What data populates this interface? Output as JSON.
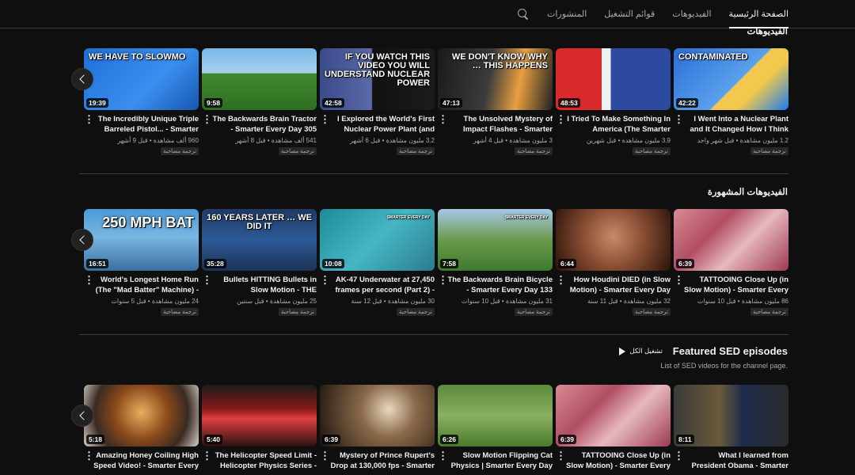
{
  "tabs": [
    {
      "label": "الصفحة الرئيسية",
      "active": true
    },
    {
      "label": "الفيديوهات",
      "active": false
    },
    {
      "label": "قوائم التشغيل",
      "active": false
    },
    {
      "label": "المنشورات",
      "active": false
    }
  ],
  "section_videos": {
    "title": "الفيديوهات",
    "items": [
      {
        "title": "I Went Into a Nuclear Plant and It Changed How I Think",
        "stats": "1.2 مليون مشاهدة • قبل شهر واحد",
        "duration": "42:22",
        "badge": "ترجمة مصاحبة",
        "overlay": "CONTAMINATED"
      },
      {
        "title": "I Tried To Make Something In America (The Smarter",
        "stats": "3.9 مليون مشاهدة • قبل شهرين",
        "duration": "48:53",
        "badge": "ترجمة مصاحبة",
        "overlay": ""
      },
      {
        "title": "The Unsolved Mystery of Impact Flashes - Smarter",
        "stats": "3 مليون مشاهدة • قبل 4 أشهر",
        "duration": "47:13",
        "badge": "ترجمة مصاحبة",
        "overlay": "WE DON'T KNOW WHY … THIS HAPPENS"
      },
      {
        "title": "I Explored the World's First Nuclear Power Plant (and",
        "stats": "3.2 مليون مشاهدة • قبل 6 أشهر",
        "duration": "42:58",
        "badge": "ترجمة مصاحبة",
        "overlay": "IF YOU WATCH THIS VIDEO YOU WILL UNDERSTAND NUCLEAR POWER"
      },
      {
        "title": "The Backwards Brain Tractor - Smarter Every Day 305",
        "stats": "541 ألف مشاهدة • قبل 8 أشهر",
        "duration": "9:58",
        "badge": "ترجمة مصاحبة",
        "overlay": ""
      },
      {
        "title": "The Incredibly Unique Triple Barreled Pistol... - Smarter",
        "stats": "960 ألف مشاهدة • قبل 9 أشهر",
        "duration": "19:39",
        "badge": "ترجمة مصاحبة",
        "overlay": "WE HAVE TO SLOWMO"
      }
    ]
  },
  "section_popular": {
    "title": "الفيديوهات المشهورة",
    "items": [
      {
        "title": "TATTOOING Close Up (in Slow Motion) - Smarter Every",
        "stats": "86 مليون مشاهدة • قبل 10 سنوات",
        "duration": "6:39",
        "badge": "ترجمة مصاحبة",
        "overlay": ""
      },
      {
        "title": "How Houdini DIED (in Slow Motion) - Smarter Every Day",
        "stats": "32 مليون مشاهدة • قبل 11 سنة",
        "duration": "6:44",
        "badge": "ترجمة مصاحبة",
        "overlay": ""
      },
      {
        "title": "The Backwards Brain Bicycle - Smarter Every Day 133",
        "stats": "31 مليون مشاهدة • قبل 10 سنوات",
        "duration": "7:58",
        "badge": "ترجمة مصاحبة",
        "overlay": "SMARTER EVERY DAY"
      },
      {
        "title": "AK-47 Underwater at 27,450 frames per second (Part 2) -",
        "stats": "30 مليون مشاهدة • قبل 12 سنة",
        "duration": "10:08",
        "badge": "ترجمة مصاحبة",
        "overlay": "SMARTER EVERY DAY"
      },
      {
        "title": "Bullets HITTING Bullets in Slow Motion - THE",
        "stats": "25 مليون مشاهدة • قبل سنتين",
        "duration": "35:28",
        "badge": "ترجمة مصاحبة",
        "overlay": "160 YEARS LATER … WE DID IT"
      },
      {
        "title": "World's Longest Home Run (The \"Mad Batter\" Machine) -",
        "stats": "24 مليون مشاهدة • قبل 5 سنوات",
        "duration": "16:51",
        "badge": "ترجمة مصاحبة",
        "overlay": "250 MPH BAT"
      }
    ]
  },
  "section_featured": {
    "title": "Featured SED episodes",
    "subtitle": "List of SED videos for the channel page.",
    "play_all": "تشغيل الكل",
    "items": [
      {
        "title": "What I learned from President Obama - Smarter",
        "duration": "8:11"
      },
      {
        "title": "TATTOOING Close Up (in Slow Motion) - Smarter Every",
        "duration": "6:39"
      },
      {
        "title": "Slow Motion Flipping Cat Physics | Smarter Every Day",
        "duration": "6:26"
      },
      {
        "title": "Mystery of Prince Rupert's Drop at 130,000 fps - Smarter",
        "duration": "6:39"
      },
      {
        "title": "The Helicopter Speed Limit - Helicopter Physics Series -",
        "duration": "5:40"
      },
      {
        "title": "Amazing Honey Coiling High Speed Video! - Smarter Every",
        "duration": "5:18"
      }
    ]
  }
}
